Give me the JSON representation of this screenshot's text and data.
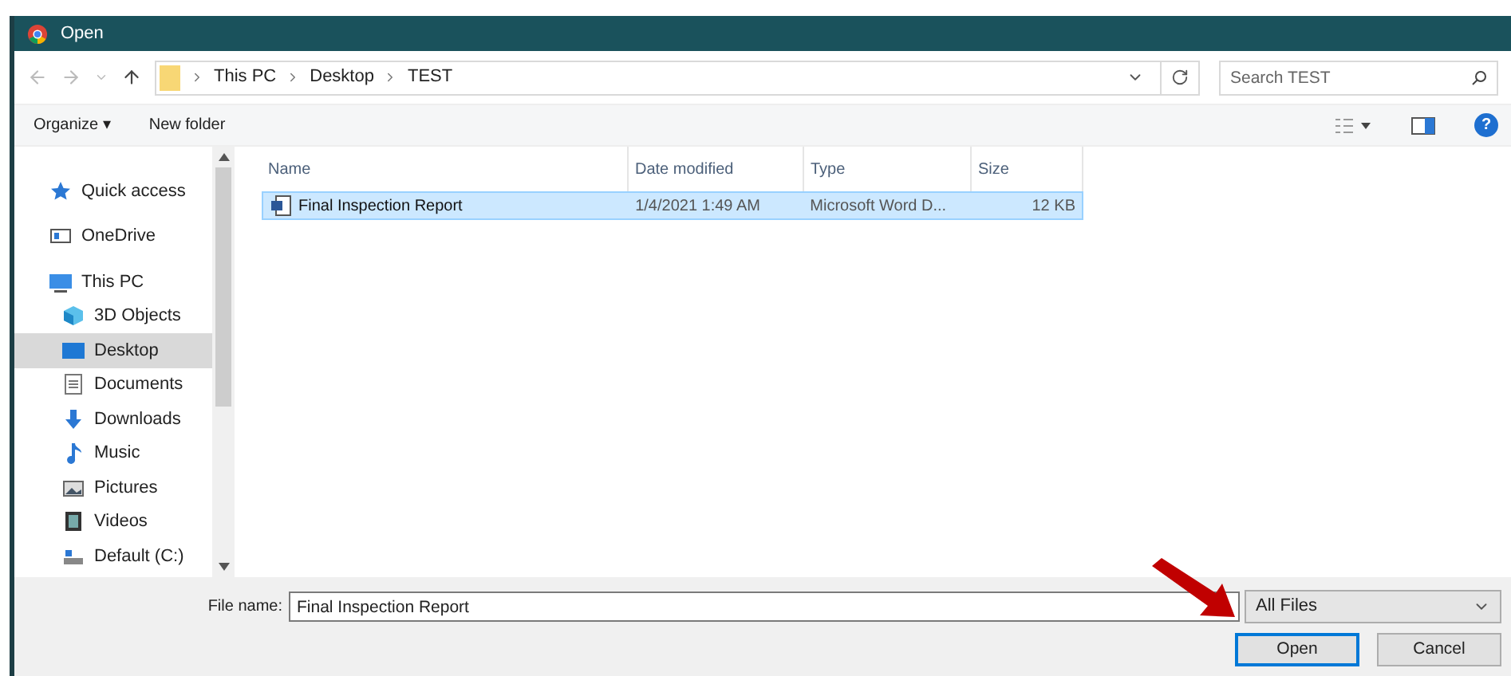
{
  "window": {
    "title": "Open"
  },
  "address": {
    "crumbs": [
      "This PC",
      "Desktop",
      "TEST"
    ],
    "search_placeholder": "Search TEST"
  },
  "toolbar": {
    "organize": "Organize ▾",
    "new_folder": "New folder",
    "help": "?"
  },
  "sidebar": {
    "items": [
      {
        "label": "Quick access",
        "selected": false
      },
      {
        "label": "OneDrive",
        "selected": false
      },
      {
        "label": "This PC",
        "selected": false,
        "children": [
          {
            "label": "3D Objects",
            "selected": false
          },
          {
            "label": "Desktop",
            "selected": true
          },
          {
            "label": "Documents",
            "selected": false
          },
          {
            "label": "Downloads",
            "selected": false
          },
          {
            "label": "Music",
            "selected": false
          },
          {
            "label": "Pictures",
            "selected": false
          },
          {
            "label": "Videos",
            "selected": false
          },
          {
            "label": "Default (C:)",
            "selected": false
          }
        ]
      }
    ]
  },
  "table": {
    "columns": [
      "Name",
      "Date modified",
      "Type",
      "Size"
    ],
    "rows": [
      {
        "cells": [
          "Final Inspection Report",
          "1/4/2021 1:49 AM",
          "Microsoft Word D...",
          "12 KB"
        ],
        "selected": true
      }
    ]
  },
  "footer": {
    "file_name_label": "File name:",
    "file_name": "Final Inspection Report",
    "filter": "All Files",
    "open": "Open",
    "cancel": "Cancel"
  }
}
